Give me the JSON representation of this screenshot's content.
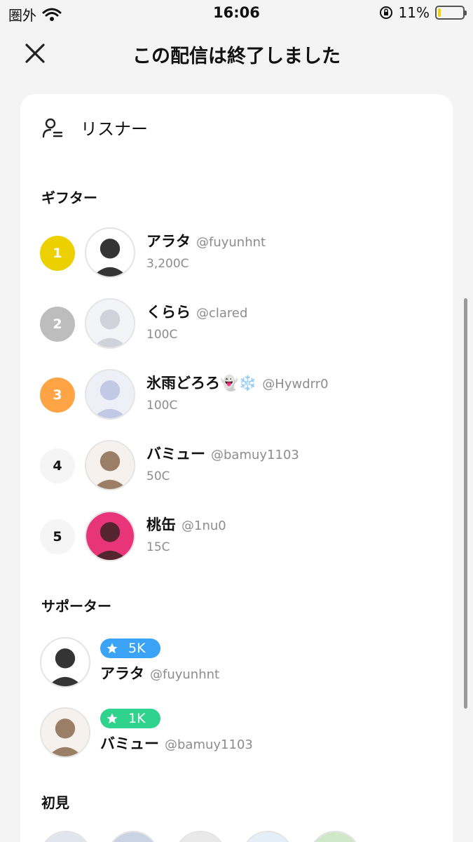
{
  "status_bar": {
    "carrier": "圏外",
    "time": "16:06",
    "battery_percent": "11%",
    "battery_level": 0.11
  },
  "header": {
    "title": "この配信は終了しました"
  },
  "listener": {
    "label": "リスナー"
  },
  "sections": {
    "gifters": "ギフター",
    "supporters": "サポーター",
    "first_timers": "初見"
  },
  "gifters": [
    {
      "rank": "1",
      "rank_color": "#ecd000",
      "name": "アラタ",
      "handle": "@fuyunhnt",
      "amount": "3,200C",
      "avatar_colors": [
        "#ffffff",
        "#111111"
      ]
    },
    {
      "rank": "2",
      "rank_color": "#bdbdbd",
      "name": "くらら",
      "handle": "@clared",
      "amount": "100C",
      "avatar_colors": [
        "#f3f4f7",
        "#c9ccd6"
      ]
    },
    {
      "rank": "3",
      "rank_color": "#ffa444",
      "name": "氷雨どろろ👻❄️",
      "handle": "@Hywdrr0",
      "amount": "100C",
      "avatar_colors": [
        "#eef0f8",
        "#b9c2e0"
      ]
    },
    {
      "rank": "4",
      "rank_color": "",
      "name": "バミュー",
      "handle": "@bamuy1103",
      "amount": "50C",
      "avatar_colors": [
        "#f6f1ec",
        "#8a6a4f"
      ]
    },
    {
      "rank": "5",
      "rank_color": "",
      "name": "桃缶",
      "handle": "@1nu0",
      "amount": "15C",
      "avatar_colors": [
        "#e8357a",
        "#3a2222"
      ]
    }
  ],
  "supporters": [
    {
      "badge": "5K",
      "badge_color": "#3aa3f5",
      "name": "アラタ",
      "handle": "@fuyunhnt",
      "avatar_colors": [
        "#ffffff",
        "#111111"
      ]
    },
    {
      "badge": "1K",
      "badge_color": "#2fd38d",
      "name": "バミュー",
      "handle": "@bamuy1103",
      "avatar_colors": [
        "#f6f1ec",
        "#8a6a4f"
      ]
    }
  ],
  "first_timers": [
    {
      "avatar_colors": [
        "#dfe6ee",
        "#34495e"
      ]
    },
    {
      "avatar_colors": [
        "#c9d3e3",
        "#6a7b97"
      ]
    },
    {
      "avatar_colors": [
        "#e9e9e9",
        "#222222"
      ]
    },
    {
      "avatar_colors": [
        "#e3eef7",
        "#86a9c7"
      ]
    },
    {
      "avatar_colors": [
        "#cfe8c8",
        "#3f7d3a"
      ]
    }
  ]
}
